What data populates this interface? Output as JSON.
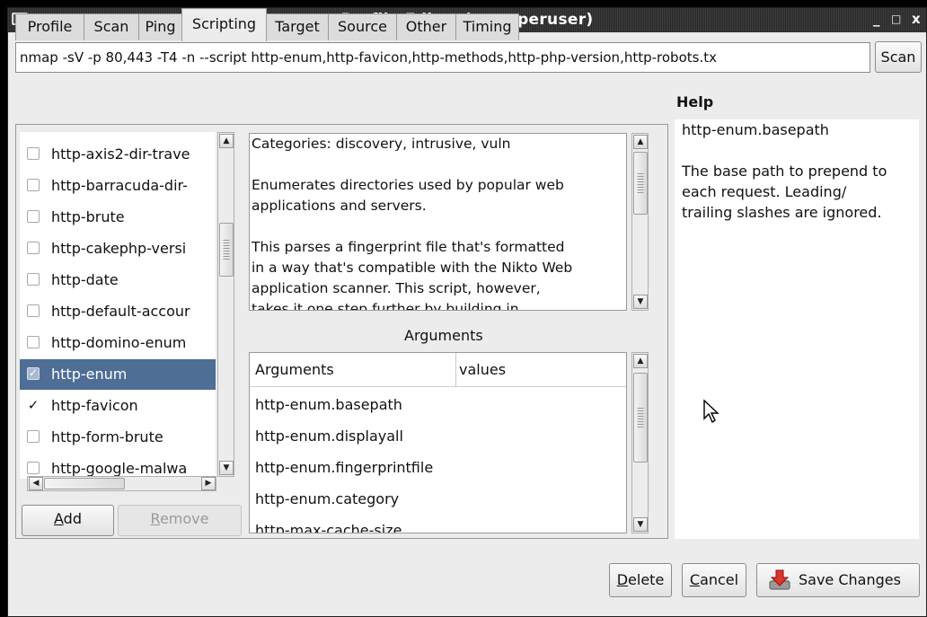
{
  "window": {
    "title": "Profile Editor (as superuser)",
    "minimize": "_",
    "maximize": "□",
    "close": "x"
  },
  "command": {
    "value": "nmap -sV -p 80,443 -T4 -n --script http-enum,http-favicon,http-methods,http-php-version,http-robots.tx",
    "scan_label": "Scan"
  },
  "tabs": [
    {
      "label": "Profile"
    },
    {
      "label": "Scan"
    },
    {
      "label": "Ping"
    },
    {
      "label": "Scripting",
      "active": true
    },
    {
      "label": "Target"
    },
    {
      "label": "Source"
    },
    {
      "label": "Other"
    },
    {
      "label": "Timing"
    }
  ],
  "scripts": [
    {
      "label": "http-axis2-dir-trave",
      "checked": false
    },
    {
      "label": "http-barracuda-dir-",
      "checked": false
    },
    {
      "label": "http-brute",
      "checked": false
    },
    {
      "label": "http-cakephp-versi",
      "checked": false
    },
    {
      "label": "http-date",
      "checked": false
    },
    {
      "label": "http-default-accour",
      "checked": false
    },
    {
      "label": "http-domino-enum",
      "checked": false
    },
    {
      "label": "http-enum",
      "checked": true,
      "selected": true
    },
    {
      "label": "http-favicon",
      "checked": true
    },
    {
      "label": "http-form-brute",
      "checked": false
    },
    {
      "label": "http-google-malwa",
      "checked": false
    }
  ],
  "list_buttons": {
    "add": "Add",
    "remove": "Remove"
  },
  "description": {
    "lines": [
      "Categories: discovery, intrusive, vuln",
      "",
      "Enumerates directories used by popular web",
      "applications and servers.",
      "",
      "This parses a fingerprint file that's formatted",
      "in a way that's compatible with the Nikto Web",
      "application scanner. This script, however,",
      "takes it one step further by building in"
    ]
  },
  "arguments": {
    "section_label": "Arguments",
    "col_args": "Arguments",
    "col_values": "values",
    "rows": [
      "http-enum.basepath",
      "http-enum.displayall",
      "http-enum.fingerprintfile",
      "http-enum.category",
      "http-max-cache-size"
    ]
  },
  "help": {
    "heading": "Help",
    "arg_name": "http-enum.basepath",
    "lines": [
      "The base path to prepend to",
      "each request. Leading/",
      "trailing slashes are ignored."
    ]
  },
  "footer": {
    "delete": "Delete",
    "cancel": "Cancel",
    "save": "Save Changes"
  }
}
